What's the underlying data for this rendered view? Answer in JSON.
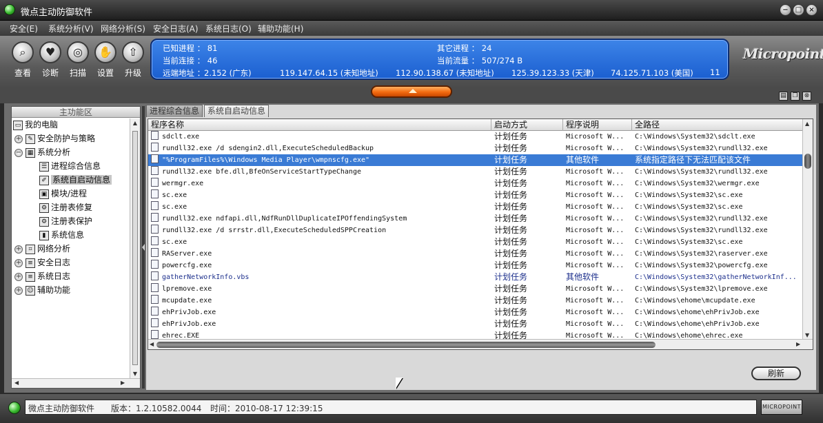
{
  "window": {
    "title": "微点主动防御软件"
  },
  "menu": [
    "安全(E)",
    "系统分析(V)",
    "网络分析(S)",
    "安全日志(A)",
    "系统日志(O)",
    "辅助功能(H)"
  ],
  "toolbar": {
    "buttons": [
      {
        "label": "查看",
        "icon": "magnifier-icon"
      },
      {
        "label": "诊断",
        "icon": "heart-icon"
      },
      {
        "label": "扫描",
        "icon": "scan-icon"
      },
      {
        "label": "设置",
        "icon": "hand-icon"
      },
      {
        "label": "升级",
        "icon": "upgrade-arrow-icon"
      }
    ]
  },
  "info": {
    "known_processes": "已知进程 ： 81",
    "other_processes": "其它进程 ： 24",
    "current_connections": "当前连接 ： 46",
    "current_traffic": "当前流量 ： 507/274 B",
    "remote_label": "远端地址 ：",
    "remote_addresses": [
      "2.152 (广东)",
      "119.147.64.15 (未知地址)",
      "112.90.138.67 (未知地址)",
      "125.39.123.33 (天津)",
      "74.125.71.103 (美国)",
      "11"
    ]
  },
  "logo": "Micropoint",
  "left_panel": {
    "header": "主功能区",
    "tree": [
      {
        "label": "我的电脑",
        "level": 0,
        "expander": "",
        "selected": false
      },
      {
        "label": "安全防护与策略",
        "level": 1,
        "expander": "+",
        "selected": false
      },
      {
        "label": "系统分析",
        "level": 1,
        "expander": "−",
        "selected": false
      },
      {
        "label": "进程综合信息",
        "level": 2,
        "expander": "",
        "selected": false
      },
      {
        "label": "系统自启动信息",
        "level": 2,
        "expander": "",
        "selected": true
      },
      {
        "label": "模块/进程",
        "level": 2,
        "expander": "",
        "selected": false
      },
      {
        "label": "注册表修复",
        "level": 2,
        "expander": "",
        "selected": false
      },
      {
        "label": "注册表保护",
        "level": 2,
        "expander": "",
        "selected": false
      },
      {
        "label": "系统信息",
        "level": 2,
        "expander": "",
        "selected": false
      },
      {
        "label": "网络分析",
        "level": 1,
        "expander": "+",
        "selected": false
      },
      {
        "label": "安全日志",
        "level": 1,
        "expander": "+",
        "selected": false
      },
      {
        "label": "系统日志",
        "level": 1,
        "expander": "+",
        "selected": false
      },
      {
        "label": "辅助功能",
        "level": 1,
        "expander": "+",
        "selected": false
      }
    ]
  },
  "tabs": [
    {
      "label": "进程综合信息",
      "active": false
    },
    {
      "label": "系统自启动信息",
      "active": true
    }
  ],
  "table": {
    "columns": [
      "程序名称",
      "启动方式",
      "程序说明",
      "全路径"
    ],
    "rows": [
      [
        "sdclt.exe",
        "计划任务",
        "Microsoft W...",
        "C:\\Windows\\System32\\sdclt.exe"
      ],
      [
        "rundll32.exe /d sdengin2.dll,ExecuteScheduledBackup",
        "计划任务",
        "Microsoft W...",
        "C:\\Windows\\System32\\rundll32.exe"
      ],
      [
        "\"%ProgramFiles%\\Windows Media Player\\wmpnscfg.exe\"",
        "计划任务",
        "其他软件",
        "系统指定路径下无法匹配该文件"
      ],
      [
        "rundll32.exe bfe.dll,BfeOnServiceStartTypeChange",
        "计划任务",
        "Microsoft W...",
        "C:\\Windows\\System32\\rundll32.exe"
      ],
      [
        "wermgr.exe",
        "计划任务",
        "Microsoft W...",
        "C:\\Windows\\System32\\wermgr.exe"
      ],
      [
        "sc.exe",
        "计划任务",
        "Microsoft W...",
        "C:\\Windows\\System32\\sc.exe"
      ],
      [
        "sc.exe",
        "计划任务",
        "Microsoft W...",
        "C:\\Windows\\System32\\sc.exe"
      ],
      [
        "rundll32.exe ndfapi.dll,NdfRunDllDuplicateIPOffendingSystem",
        "计划任务",
        "Microsoft W...",
        "C:\\Windows\\System32\\rundll32.exe"
      ],
      [
        "rundll32.exe /d srrstr.dll,ExecuteScheduledSPPCreation",
        "计划任务",
        "Microsoft W...",
        "C:\\Windows\\System32\\rundll32.exe"
      ],
      [
        "sc.exe",
        "计划任务",
        "Microsoft W...",
        "C:\\Windows\\System32\\sc.exe"
      ],
      [
        "RAServer.exe",
        "计划任务",
        "Microsoft W...",
        "C:\\Windows\\System32\\raserver.exe"
      ],
      [
        "powercfg.exe",
        "计划任务",
        "Microsoft W...",
        "C:\\Windows\\System32\\powercfg.exe"
      ],
      [
        "gatherNetworkInfo.vbs",
        "计划任务",
        "其他软件",
        "C:\\Windows\\System32\\gatherNetworkInf..."
      ],
      [
        "lpremove.exe",
        "计划任务",
        "Microsoft W...",
        "C:\\Windows\\System32\\lpremove.exe"
      ],
      [
        "mcupdate.exe",
        "计划任务",
        "Microsoft W...",
        "C:\\Windows\\ehome\\mcupdate.exe"
      ],
      [
        "ehPrivJob.exe",
        "计划任务",
        "Microsoft W...",
        "C:\\Windows\\ehome\\ehPrivJob.exe"
      ],
      [
        "ehPrivJob.exe",
        "计划任务",
        "Microsoft W...",
        "C:\\Windows\\ehome\\ehPrivJob.exe"
      ],
      [
        "ehrec.EXE",
        "计划任务",
        "Microsoft W...",
        "C:\\Windows\\ehome\\ehrec.exe"
      ]
    ],
    "selected_row": 2,
    "highlight_rows": [
      12
    ]
  },
  "refresh_label": "刷新",
  "status": {
    "app": "微点主动防御软件",
    "version": "版本：1.2.10582.0044",
    "time": "时间：2010-08-17 12:39:15",
    "brand": "MICROPOINT"
  }
}
